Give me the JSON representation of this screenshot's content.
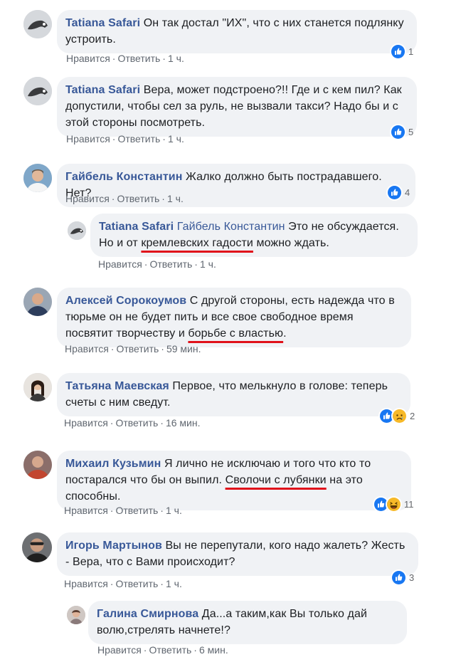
{
  "actions": {
    "like": "Нравится",
    "reply": "Ответить",
    "sep": "·"
  },
  "comments": [
    {
      "author": "Tatiana Safari",
      "text": "Он так достал \"ИХ\", что с них станется подлянку устроить.",
      "time": "1 ч.",
      "reactions": [
        "like-icon"
      ],
      "count": "1"
    },
    {
      "author": "Tatiana Safari",
      "text": "Вера, может подстроено?!! Где и с кем пил? Как допустили, чтобы сел за руль, не вызвали такси? Надо бы и с этой стороны посмотреть.",
      "time": "1 ч.",
      "reactions": [
        "like-icon"
      ],
      "count": "5"
    },
    {
      "author": "Гайбель Константин",
      "text": "Жалко должно быть пострадавшего. Нет?",
      "time": "1 ч.",
      "reactions": [
        "like-icon"
      ],
      "count": "4"
    },
    {
      "author": "Tatiana Safari",
      "mention": "Гайбель Константин",
      "text_a": "Это не обсуждается. Но и от ",
      "text_u": "кремлевских гадости",
      "text_b": " можно ждать.",
      "time": "1 ч."
    },
    {
      "author": "Алексей Сорокоумов",
      "text_a": "С другой стороны, есть надежда что в тюрьме он не будет пить и все свое свободное время посвятит творчеству и ",
      "text_u": "борьбе с властью",
      "text_b": ".",
      "time": "59 мин."
    },
    {
      "author": "Татьяна Маевская",
      "text": "Первое, что мелькнуло в голове: теперь счеты с ним сведут.",
      "time": "16 мин.",
      "reactions": [
        "like-icon",
        "sad-icon"
      ],
      "count": "2"
    },
    {
      "author": "Михаил Кузьмин",
      "text_a": "Я лично не исключаю и того что кто то постарался что бы он выпил. ",
      "text_u": "Сволочи с лубянки",
      "text_b": " на это способны.",
      "time": "1 ч.",
      "reactions": [
        "like-icon",
        "haha-icon"
      ],
      "count": "11"
    },
    {
      "author": "Игорь Мартынов",
      "text": "Вы не перепутали, кого надо жалеть? Жесть - Вера, что с Вами происходит?",
      "time": "1 ч.",
      "reactions": [
        "like-icon"
      ],
      "count": "3"
    },
    {
      "author": "Галина Смирнова",
      "text": "Да...а таким,как Вы только дай волю,стрелять начнете!?",
      "time": "6 мин."
    }
  ],
  "colors": {
    "link": "#385898",
    "bubble": "#f0f2f5",
    "meta": "#606770",
    "underline": "#e0121b",
    "like": "#1877f2",
    "emoji": "#f7b928"
  }
}
